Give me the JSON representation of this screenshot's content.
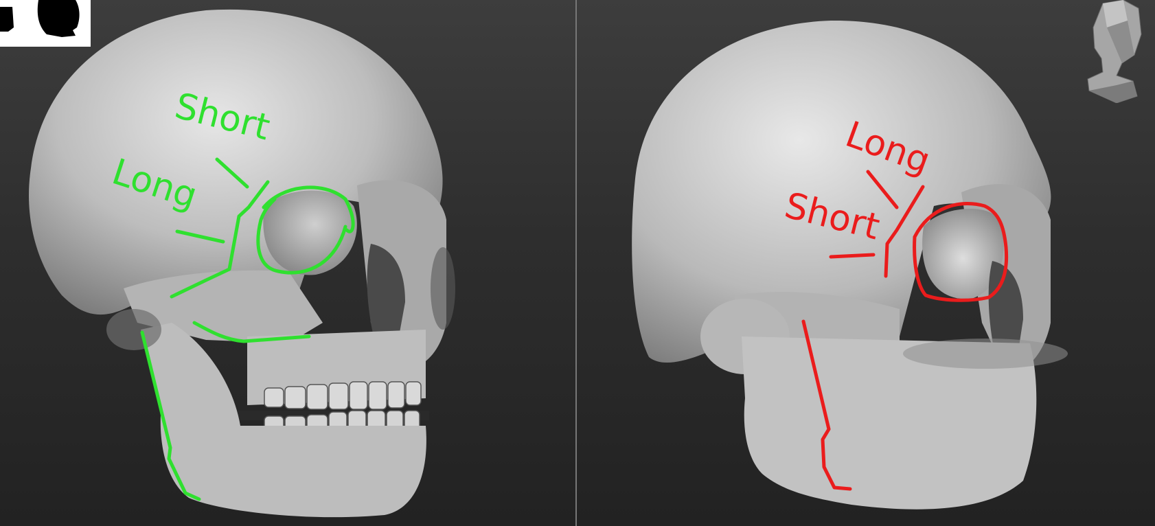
{
  "left_viewport": {
    "annotations": {
      "short_label": "Short",
      "long_label": "Long"
    },
    "annotation_color": "#2fe02f"
  },
  "right_viewport": {
    "annotations": {
      "long_label": "Long",
      "short_label": "Short"
    },
    "annotation_color": "#ea1c1c"
  },
  "icons": {
    "thumbnail": "silhouette-thumbnail-icon",
    "navigation": "head-navigation-cube-icon"
  },
  "colors": {
    "background": "#2e2e2e",
    "skull": "#c9c9c9",
    "divider": "#777777"
  }
}
